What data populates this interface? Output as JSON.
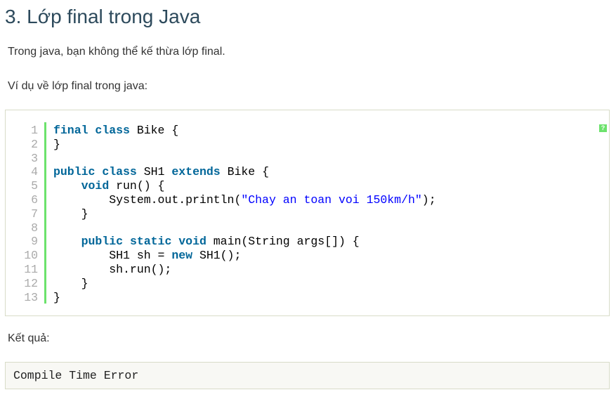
{
  "title": "3. Lớp final trong Java",
  "intro": "Trong java, bạn không thể kế thừa lớp final.",
  "example_label": "Ví dụ về lớp final trong java:",
  "code_help_icon": "?",
  "code_lines": [
    [
      [
        "kw",
        "final"
      ],
      [
        "t",
        " "
      ],
      [
        "kw",
        "class"
      ],
      [
        "t",
        " Bike {"
      ]
    ],
    [
      [
        "t",
        "}"
      ]
    ],
    [],
    [
      [
        "kw",
        "public"
      ],
      [
        "t",
        " "
      ],
      [
        "kw",
        "class"
      ],
      [
        "t",
        " SH1 "
      ],
      [
        "kw",
        "extends"
      ],
      [
        "t",
        " Bike {"
      ]
    ],
    [
      [
        "t",
        "    "
      ],
      [
        "kw",
        "void"
      ],
      [
        "t",
        " run() {"
      ]
    ],
    [
      [
        "t",
        "        System.out.println("
      ],
      [
        "str",
        "\"Chay an toan voi 150km/h\""
      ],
      [
        "t",
        ");"
      ]
    ],
    [
      [
        "t",
        "    }"
      ]
    ],
    [],
    [
      [
        "t",
        "    "
      ],
      [
        "kw",
        "public"
      ],
      [
        "t",
        " "
      ],
      [
        "kw",
        "static"
      ],
      [
        "t",
        " "
      ],
      [
        "kw",
        "void"
      ],
      [
        "t",
        " main(String args[]) {"
      ]
    ],
    [
      [
        "t",
        "        SH1 sh = "
      ],
      [
        "kw",
        "new"
      ],
      [
        "t",
        " SH1();"
      ]
    ],
    [
      [
        "t",
        "        sh.run();"
      ]
    ],
    [
      [
        "t",
        "    }"
      ]
    ],
    [
      [
        "t",
        "}"
      ]
    ]
  ],
  "result_label": "Kết quả:",
  "result_output": "Compile Time Error"
}
